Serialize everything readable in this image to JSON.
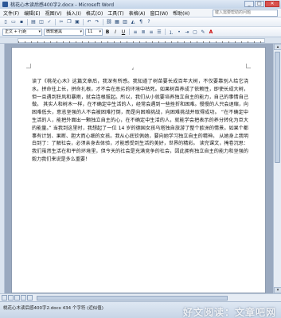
{
  "window": {
    "title": "桃花心木读后感400字2.docx - Microsoft Word",
    "min": "_",
    "max": "□",
    "close": "✕"
  },
  "menu": {
    "items": [
      "文件(F)",
      "编辑(E)",
      "视图(V)",
      "插入(I)",
      "格式(O)",
      "工具(T)",
      "表格(A)",
      "窗口(W)",
      "帮助(H)"
    ],
    "help_placeholder": "键入需要帮助的问题"
  },
  "format_toolbar": {
    "style": "正文 + 行距",
    "font": "微软雅黑",
    "size": "11",
    "bold": "B",
    "italic": "I",
    "underline": "U",
    "font_color_letter": "A"
  },
  "document": {
    "body": "读了《桃花心木》这篇文章后，我深有所感。我知道了树苗要长成百年大树，不仅要靠别人给它浇水，拼命往上长，拼命扎根，才不会在恶劣的环境中枯死。如果树苗养成了依赖性，即使长成大树，但一旦遇到狂风和暴雨，就会连根拔起。所以，我们从小就要培养独立自主的能力，自己的事情自己做。 其实人和树木一样，在不确定中生活的人，经常会遇到一些挫折和困难。慢慢的人只会退缩，向困难低头，意志坚强的人不会被困难打倒，而是向困难挑战，向困难挑战并取得成功。 “在不确定中生活的人，能把外面出一颗独立自主的心，在不确定中生活的人，就能学会把表示的养分转化为巨大的能量。” 当我到这里时，我想起了一位 14 岁的德国女孩乌塔独自旅游了整个欧洲的情景。如果个都事有计划、果断、胆大而心细的女孩。我从心底钦佩她，要向她学习独立自主的精神。 从她身上我明白到了：了解社会，必须亲身去体验，才能感受到生活的美好，世界的精彩。 读完课文，掩卷沉思：我们虽然生活在和平的环境里，但今天的社会是充满竞争的社会，因此拥有独立自主的能力和坚强的毅力我们来说是多么重要！"
  },
  "status": {
    "left": "桃花心木读后感400字2.docx  434 个字符 (近似值)",
    "watermark": "好文阅读：文章吧网"
  }
}
